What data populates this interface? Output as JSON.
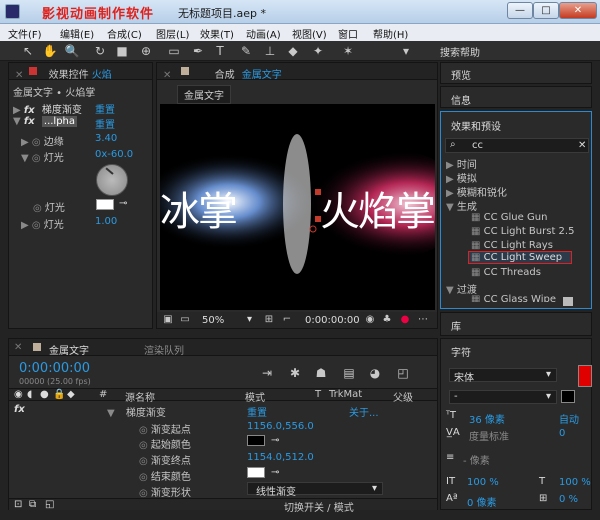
{
  "titlebar": {
    "watermark": "影视动画制作软件",
    "title": "无标题项目.aep *"
  },
  "menubar": {
    "items": [
      "文件(F)",
      "编辑(E)",
      "合成(C)",
      "图层(L)",
      "效果(T)",
      "动画(A)",
      "视图(V)",
      "窗口",
      "帮助(H)"
    ]
  },
  "toolbar": {
    "search_help": "搜索帮助"
  },
  "effect_controls": {
    "tab_label": "效果控件",
    "tab_target": "火焰",
    "subtitle": "金属文字 • 火焰掌",
    "effects": [
      {
        "name": "梯度渐变",
        "action": "重置"
      },
      {
        "name": "...lpha",
        "action": "重置"
      }
    ],
    "props": [
      {
        "label": "边缘",
        "value": "3.40"
      },
      {
        "label": "灯光",
        "value": "0x-60.0"
      },
      {
        "label": "灯光",
        "value": ""
      },
      {
        "label": "灯光",
        "value": "1.00"
      }
    ]
  },
  "composition": {
    "tab_label": "合成",
    "tab_name": "金属文字",
    "chip": "金属文字",
    "preview_left": "冰掌",
    "preview_right": "火焰掌",
    "zoom": "50%",
    "timecode": "0:00:00:00"
  },
  "right": {
    "preview": "预览",
    "info": "信息",
    "effects_presets": "效果和预设",
    "search_value": "cc",
    "categories": [
      {
        "name": "时间",
        "open": false
      },
      {
        "name": "模拟",
        "open": false
      },
      {
        "name": "模糊和锐化",
        "open": false
      },
      {
        "name": "生成",
        "open": true
      },
      {
        "name": "过渡",
        "open": true
      }
    ],
    "generate_items": [
      "CC Glue Gun",
      "CC Light Burst 2.5",
      "CC Light Rays",
      "CC Light Sweep",
      "CC Threads"
    ],
    "transition_partial": "CC Glass Wipe",
    "library": "库",
    "character": "字符",
    "font": "宋体",
    "font_style": "-",
    "size": "36 像素",
    "auto_leading": "自动",
    "tracking_label": "度量标准",
    "tracking_value": "0",
    "kern": "- 像素",
    "vscale": "100 %",
    "hscale": "100 %",
    "baseline": "0 像素",
    "tsume": "0 %"
  },
  "timeline": {
    "tab": "金属文字",
    "render_tab": "渲染队列",
    "timecode": "0:00:00:00",
    "fps": "00000 (25.00 fps)",
    "columns": [
      "#",
      "源名称",
      "模式",
      "T",
      "TrkMat",
      "父级"
    ],
    "rows": [
      {
        "name": "梯度渐变",
        "value": "重置",
        "extra": "关于..."
      },
      {
        "name": "渐变起点",
        "value": "1156.0,556.0"
      },
      {
        "name": "起始颜色",
        "value": ""
      },
      {
        "name": "渐变终点",
        "value": "1154.0,512.0"
      },
      {
        "name": "结束颜色",
        "value": ""
      },
      {
        "name": "渐变形状",
        "value": "线性渐变"
      }
    ],
    "footer": "切换开关 / 模式"
  },
  "colors": {
    "accent": "#2a9ae2",
    "red": "#e00000"
  }
}
